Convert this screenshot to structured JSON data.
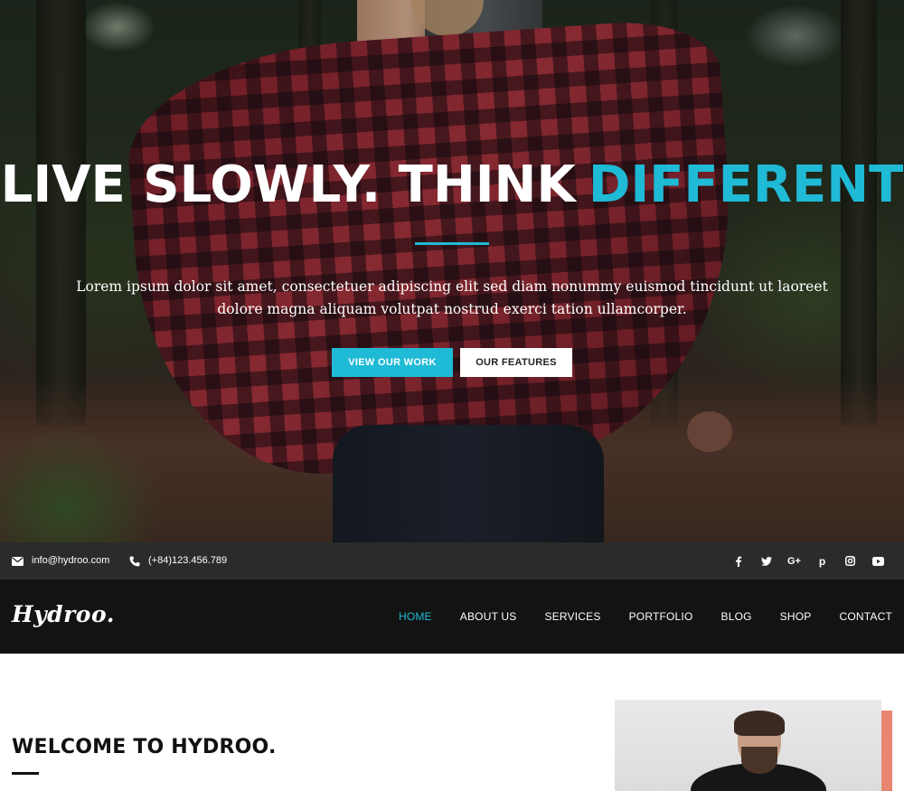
{
  "hero": {
    "title_main": "LIVE SLOWLY. THINK",
    "title_accent": "DIFFERENT",
    "text": "Lorem ipsum dolor sit amet, consectetuer adipiscing elit sed diam nonummy euismod tincidunt ut laoreet dolore magna aliquam volutpat nostrud exerci tation ullamcorper.",
    "btn_primary": "VIEW OUR WORK",
    "btn_secondary": "OUR FEATURES"
  },
  "topbar": {
    "email": "info@hydroo.com",
    "phone": "(+84)123.456.789",
    "social": [
      {
        "name": "facebook",
        "glyph": "f"
      },
      {
        "name": "twitter",
        "glyph": "t"
      },
      {
        "name": "google-plus",
        "glyph": "G+"
      },
      {
        "name": "pinterest",
        "glyph": "p"
      },
      {
        "name": "instagram",
        "glyph": "ig"
      },
      {
        "name": "youtube",
        "glyph": "yt"
      }
    ]
  },
  "nav": {
    "logo": "Hydroo.",
    "items": [
      "HOME",
      "ABOUT US",
      "SERVICES",
      "PORTFOLIO",
      "BLOG",
      "SHOP",
      "CONTACT"
    ],
    "active": "HOME"
  },
  "welcome": {
    "title": "WELCOME TO HYDROO."
  },
  "colors": {
    "accent": "#1fbad6",
    "topbar": "#2b2b2b",
    "navbar": "#131313",
    "coral": "#e88672"
  }
}
